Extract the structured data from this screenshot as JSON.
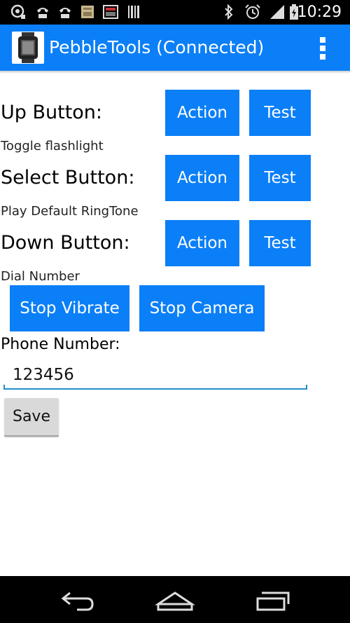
{
  "status_bar": {
    "time": "10:29",
    "icons": [
      "usb-debug-icon",
      "voicemail-icon",
      "voicemail-icon",
      "sd-card-icon",
      "screenshot-icon",
      "barcode-icon",
      "bluetooth-icon",
      "alarm-icon",
      "signal-icon",
      "battery-icon"
    ]
  },
  "action_bar": {
    "title": "PebbleTools (Connected)",
    "app_icon": "pebble-watch-icon",
    "overflow_icon": "overflow-menu-icon"
  },
  "buttons": {
    "up": {
      "label": "Up Button:",
      "description": "Toggle flashlight",
      "action_label": "Action",
      "test_label": "Test"
    },
    "select": {
      "label": "Select Button:",
      "description": "Play Default RingTone",
      "action_label": "Action",
      "test_label": "Test"
    },
    "down": {
      "label": "Down Button:",
      "description": "Dial Number",
      "action_label": "Action",
      "test_label": "Test"
    }
  },
  "controls": {
    "stop_vibrate": "Stop Vibrate",
    "stop_camera": "Stop Camera"
  },
  "phone": {
    "label": "Phone Number:",
    "value": "123456"
  },
  "save_label": "Save",
  "nav_bar": {
    "back": "back-icon",
    "home": "home-icon",
    "recents": "recents-icon"
  },
  "colors": {
    "accent": "#0b7ff7",
    "field_underline": "#1f8fcf"
  }
}
